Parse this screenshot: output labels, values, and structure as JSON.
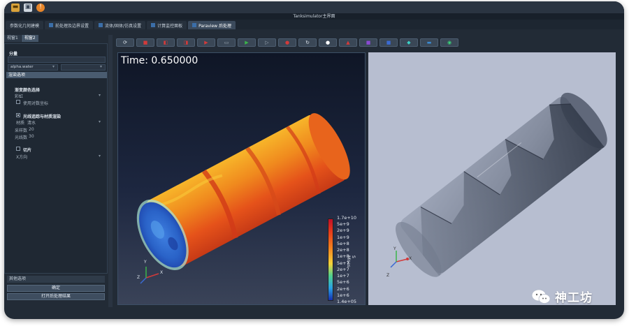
{
  "window": {
    "title": "Tanksimulator主界面"
  },
  "main_tabs": [
    {
      "label": "参数化几何建模"
    },
    {
      "label": "前处理及边界设置"
    },
    {
      "label": "流体/固体/仿真设置"
    },
    {
      "label": "计算监控面板"
    },
    {
      "label": "Paraview 后处理"
    }
  ],
  "left_panel": {
    "subtabs": [
      "视窗1",
      "视窗2"
    ],
    "component_label": "分量",
    "component_value": "",
    "field_value": "alpha.water",
    "field_secondary": "",
    "render_header": "渲染选项",
    "colormap_title": "渐变颜色选择",
    "colormap_value": "彩虹",
    "log_scale_label": "使用对数坐标",
    "log_scale_checked": false,
    "raytrace_label": "光线追踪与材质渲染",
    "raytrace_checked": true,
    "material_label": "材质",
    "material_value": "清水",
    "samples_label": "采样数",
    "samples_value": "20",
    "rays_label": "光线数",
    "rays_value": "30",
    "slice_label": "切片",
    "slice_checked": false,
    "slice_dir": "X方向",
    "other_options": "其他选项",
    "confirm_button": "确定",
    "open_button": "打开后处理结果"
  },
  "viewport_left": {
    "time_text": "Time: 0.650000",
    "colorbar_ticks": [
      "1.7e+10",
      "5e+9",
      "2e+9",
      "1e+9",
      "5e+8",
      "2e+8",
      "1e+8",
      "5e+7",
      "2e+7",
      "1e+7",
      "5e+6",
      "2e+6",
      "1e+6",
      "1.4e+05"
    ],
    "colorbar_label": "S Mises",
    "axes": [
      "Z",
      "X",
      "Y"
    ]
  },
  "viewport_right": {
    "axes": [
      "Z",
      "X",
      "Y"
    ]
  },
  "toolbar_icons": [
    "refresh-icon",
    "red-cube-icon",
    "red-cube-2-icon",
    "red-cube-3-icon",
    "red-arrow-icon",
    "slice-icon",
    "green-arrow-icon",
    "gray-arrow-icon",
    "red-sphere-icon",
    "rotate-icon",
    "white-sphere-icon",
    "red-cone-icon",
    "purple-cube-icon",
    "blue-cube-icon",
    "cyan-icon",
    "monitor-icon",
    "camera-icon"
  ],
  "watermark": {
    "text": "神工坊"
  },
  "colors": {
    "accent": "#3b6ea8",
    "background": "#222b36"
  }
}
